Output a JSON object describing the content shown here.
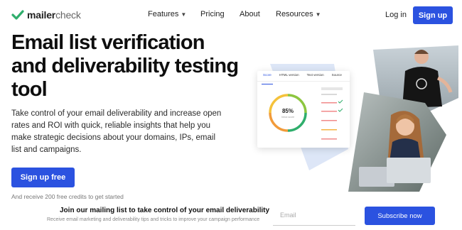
{
  "brand": {
    "name_bold": "mailer",
    "name_light": "check",
    "accent": "#2b52e0",
    "check_color": "#2fae6c"
  },
  "nav": {
    "items": [
      {
        "label": "Features",
        "has_dropdown": true
      },
      {
        "label": "Pricing",
        "has_dropdown": false
      },
      {
        "label": "About",
        "has_dropdown": false
      },
      {
        "label": "Resources",
        "has_dropdown": true
      }
    ],
    "login": "Log in",
    "signup": "Sign up"
  },
  "hero": {
    "title": "Email list verification and deliverability testing tool",
    "lead": "Take control of your email deliverability and increase open rates and ROI with quick, reliable insights that help you make strategic decisions about your domains, IPs, email list and campaigns.",
    "cta": "Sign up free",
    "credits": "And receive 200 free credits to get started"
  },
  "dashboard_card": {
    "tabs": [
      "Score",
      "HTML version",
      "Text version",
      "Source"
    ],
    "score": "85%",
    "score_label": "Inbox score"
  },
  "mailing_list": {
    "title": "Join our mailing list to take control of your email deliverability",
    "subtitle": "Receive email marketing and deliverability tips and tricks to improve your campaign performance",
    "email_placeholder": "Email",
    "subscribe": "Subscribe now"
  }
}
